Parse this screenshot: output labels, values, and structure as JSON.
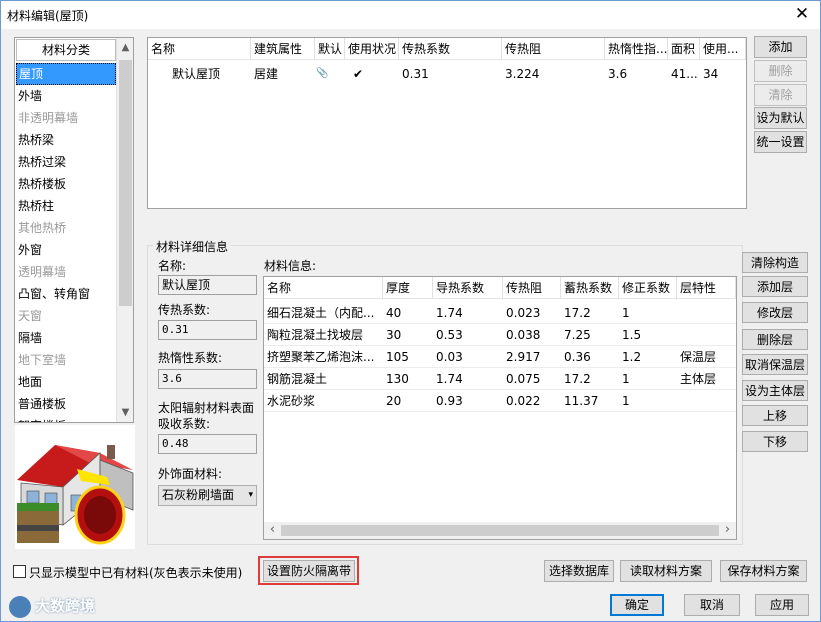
{
  "window": {
    "title": "材料编辑(屋顶)",
    "close": "✕"
  },
  "categories": {
    "header": "材料分类",
    "items": [
      {
        "label": "屋顶",
        "state": "selected"
      },
      {
        "label": "外墙",
        "state": "normal"
      },
      {
        "label": "非透明幕墙",
        "state": "gray"
      },
      {
        "label": "热桥梁",
        "state": "normal"
      },
      {
        "label": "热桥过梁",
        "state": "normal"
      },
      {
        "label": "热桥楼板",
        "state": "normal"
      },
      {
        "label": "热桥柱",
        "state": "normal"
      },
      {
        "label": "其他热桥",
        "state": "gray"
      },
      {
        "label": "外窗",
        "state": "normal"
      },
      {
        "label": "透明幕墙",
        "state": "gray"
      },
      {
        "label": "凸窗、转角窗",
        "state": "normal"
      },
      {
        "label": "天窗",
        "state": "gray"
      },
      {
        "label": "隔墙",
        "state": "normal"
      },
      {
        "label": "地下室墙",
        "state": "gray"
      },
      {
        "label": "地面",
        "state": "normal"
      },
      {
        "label": "普通楼板",
        "state": "normal"
      },
      {
        "label": "架空楼板",
        "state": "normal"
      }
    ],
    "scroll_up": "▲",
    "scroll_down": "▼"
  },
  "main_table": {
    "columns": [
      "名称",
      "建筑属性",
      "默认",
      "使用状况",
      "传热系数",
      "传热阻",
      "热惰性指...",
      "面积",
      "使用..."
    ],
    "rows": [
      {
        "name": "默认屋顶",
        "attr": "居建",
        "default_icon": "📎",
        "status_icon": "✔",
        "k": "0.31",
        "r": "3.224",
        "d": "3.6",
        "area": "41...",
        "use": "34"
      }
    ]
  },
  "side_buttons": {
    "add": "添加",
    "delete": "删除",
    "clear": "清除",
    "set_default": "设为默认",
    "unify": "统一设置"
  },
  "detail": {
    "group_title": "材料详细信息",
    "name_label": "名称:",
    "name_value": "默认屋顶",
    "k_label": "传热系数:",
    "k_value": "0.31",
    "d_label": "热惰性系数:",
    "d_value": "3.6",
    "solar_label_1": "太阳辐射材料表面",
    "solar_label_2": "吸收系数:",
    "solar_value": "0.48",
    "finish_label": "外饰面材料:",
    "finish_value": "石灰粉刷墙面",
    "info_label": "材料信息:",
    "layer_columns": [
      "名称",
      "厚度",
      "导热系数",
      "传热阻",
      "蓄热系数",
      "修正系数",
      "层特性"
    ],
    "layers": [
      {
        "name": "细石混凝土（内配...",
        "thick": "40",
        "cond": "1.74",
        "r": "0.023",
        "heat": "17.2",
        "corr": "1",
        "prop": ""
      },
      {
        "name": "陶粒混凝土找坡层",
        "thick": "30",
        "cond": "0.53",
        "r": "0.038",
        "heat": "7.25",
        "corr": "1.5",
        "prop": ""
      },
      {
        "name": "挤塑聚苯乙烯泡沫...",
        "thick": "105",
        "cond": "0.03",
        "r": "2.917",
        "heat": "0.36",
        "corr": "1.2",
        "prop": "保温层"
      },
      {
        "name": "钢筋混凝土",
        "thick": "130",
        "cond": "1.74",
        "r": "0.075",
        "heat": "17.2",
        "corr": "1",
        "prop": "主体层"
      },
      {
        "name": "水泥砂浆",
        "thick": "20",
        "cond": "0.93",
        "r": "0.022",
        "heat": "11.37",
        "corr": "1",
        "prop": ""
      }
    ],
    "scroll_left": "‹",
    "scroll_right": "›"
  },
  "layer_buttons": {
    "clear_construction": "清除构造",
    "add_layer": "添加层",
    "modify_layer": "修改层",
    "delete_layer": "删除层",
    "cancel_insulation": "取消保温层",
    "set_main": "设为主体层",
    "up": "上移",
    "down": "下移"
  },
  "bottom": {
    "checkbox_label": "只显示模型中已有材料(灰色表示未使用)",
    "fire_barrier": "设置防火隔离带",
    "select_db": "选择数据库",
    "read_scheme": "读取材料方案",
    "save_scheme": "保存材料方案",
    "ok": "确定",
    "cancel": "取消",
    "apply": "应用"
  },
  "watermark": "大数跨境",
  "colors": {
    "selection": "#3399ff",
    "highlight_border": "#e03b3b",
    "default_button_border": "#0078d7"
  }
}
